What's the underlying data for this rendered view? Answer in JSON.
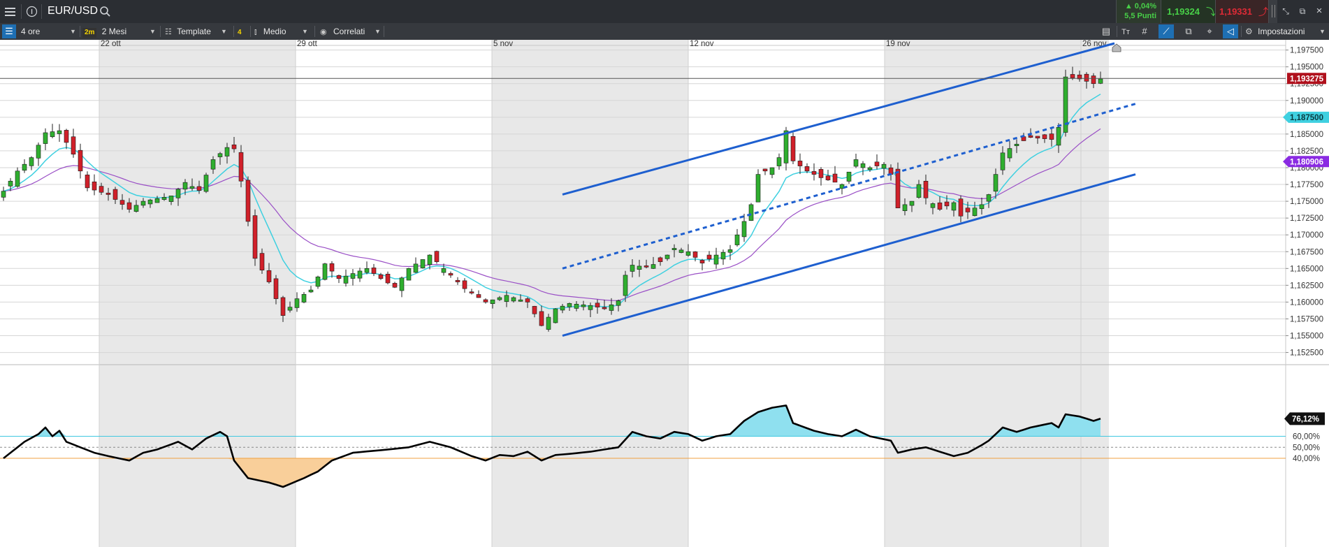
{
  "header": {
    "symbol": "EUR/USD",
    "change_pct": "▲ 0,04%",
    "change_points": "5,5 Punti",
    "sell_price": "1,19324",
    "buy_price": "1,19331"
  },
  "toolbar": {
    "interval_badge": "",
    "interval": "4 ore",
    "range_badge": "2m",
    "range": "2 Mesi",
    "template": "Template",
    "indicator_count": "4",
    "chart_style": "Medio",
    "related": "Correlati",
    "settings": "Impostazioni"
  },
  "icons": {
    "menu": "hamburger-icon",
    "info": "info-icon",
    "search": "search-icon",
    "colors": {
      "up": "#2fae2f",
      "down": "#d0202a",
      "channel": "#1e5fcf",
      "ma_fast": "#3fd0e0",
      "ma_slow": "#9a4fc6",
      "price_tag": "#b0101c",
      "fast_tag": "#3fd0e0",
      "slow_tag": "#8a2be2"
    }
  },
  "chart_data": {
    "type": "candlestick",
    "x_labels": [
      "22 ott",
      "29 ott",
      "5 nov",
      "12 nov",
      "19 nov",
      "26 nov"
    ],
    "y_ticks": [
      "1,197500",
      "1,195000",
      "1,192500",
      "1,190000",
      "1,187500",
      "1,185000",
      "1,182500",
      "1,180000",
      "1,177500",
      "1,175000",
      "1,172500",
      "1,170000",
      "1,167500",
      "1,165000",
      "1,162500",
      "1,160000",
      "1,157500",
      "1,155000",
      "1,152500"
    ],
    "ylim": [
      1.151,
      1.1985
    ],
    "price_tags": {
      "last": "1,193275",
      "ma_fast": "1,187500",
      "ma_slow": "1,180906"
    },
    "price_anchors": [
      [
        0,
        1.1765
      ],
      [
        2,
        1.1795
      ],
      [
        4,
        1.1815
      ],
      [
        6,
        1.1852
      ],
      [
        8,
        1.1855
      ],
      [
        10,
        1.182
      ],
      [
        12,
        1.177
      ],
      [
        15,
        1.176
      ],
      [
        18,
        1.1738
      ],
      [
        20,
        1.175
      ],
      [
        24,
        1.1758
      ],
      [
        26,
        1.1778
      ],
      [
        28,
        1.1766
      ],
      [
        30,
        1.1812
      ],
      [
        32,
        1.183
      ],
      [
        33,
        1.1828
      ],
      [
        34,
        1.178
      ],
      [
        35,
        1.172
      ],
      [
        36,
        1.1665
      ],
      [
        38,
        1.163
      ],
      [
        40,
        1.158
      ],
      [
        42,
        1.1605
      ],
      [
        44,
        1.1618
      ],
      [
        46,
        1.1657
      ],
      [
        48,
        1.1635
      ],
      [
        52,
        1.165
      ],
      [
        54,
        1.1635
      ],
      [
        56,
        1.1622
      ],
      [
        58,
        1.165
      ],
      [
        61,
        1.167
      ],
      [
        64,
        1.164
      ],
      [
        66,
        1.162
      ],
      [
        69,
        1.16
      ],
      [
        72,
        1.161
      ],
      [
        75,
        1.16
      ],
      [
        77,
        1.1565
      ],
      [
        79,
        1.159
      ],
      [
        81,
        1.1598
      ],
      [
        84,
        1.1595
      ],
      [
        86,
        1.159
      ],
      [
        88,
        1.1602
      ],
      [
        89,
        1.164
      ],
      [
        90,
        1.1655
      ],
      [
        92,
        1.1652
      ],
      [
        94,
        1.166
      ],
      [
        96,
        1.168
      ],
      [
        98,
        1.1675
      ],
      [
        100,
        1.1658
      ],
      [
        102,
        1.167
      ],
      [
        104,
        1.1678
      ],
      [
        105,
        1.17
      ],
      [
        106,
        1.172
      ],
      [
        107,
        1.1745
      ],
      [
        108,
        1.179
      ],
      [
        110,
        1.18
      ],
      [
        111,
        1.1815
      ],
      [
        112,
        1.1855
      ],
      [
        113,
        1.181
      ],
      [
        115,
        1.1795
      ],
      [
        117,
        1.1785
      ],
      [
        120,
        1.1775
      ],
      [
        122,
        1.1812
      ],
      [
        124,
        1.18
      ],
      [
        126,
        1.1805
      ],
      [
        127,
        1.179
      ],
      [
        128,
        1.174
      ],
      [
        130,
        1.175
      ],
      [
        131,
        1.1775
      ],
      [
        132,
        1.1755
      ],
      [
        134,
        1.1738
      ],
      [
        136,
        1.1748
      ],
      [
        137,
        1.1728
      ],
      [
        139,
        1.174
      ],
      [
        140,
        1.1745
      ],
      [
        141,
        1.176
      ],
      [
        142,
        1.179
      ],
      [
        143,
        1.1822
      ],
      [
        145,
        1.1835
      ],
      [
        147,
        1.1845
      ],
      [
        150,
        1.1842
      ],
      [
        151,
        1.186
      ],
      [
        152,
        1.1935
      ],
      [
        154,
        1.1932
      ],
      [
        156,
        1.1925
      ],
      [
        157,
        1.1932
      ]
    ],
    "oscillator": {
      "levels": [
        "60,00%",
        "50,00%",
        "40,00%"
      ],
      "last": "76,12%",
      "anchors": [
        [
          0,
          40
        ],
        [
          3,
          55
        ],
        [
          5,
          62
        ],
        [
          6,
          68
        ],
        [
          7,
          60
        ],
        [
          8,
          65
        ],
        [
          9,
          55
        ],
        [
          11,
          50
        ],
        [
          13,
          45
        ],
        [
          15,
          42
        ],
        [
          18,
          38
        ],
        [
          20,
          45
        ],
        [
          22,
          48
        ],
        [
          25,
          55
        ],
        [
          27,
          48
        ],
        [
          29,
          58
        ],
        [
          31,
          64
        ],
        [
          32,
          60
        ],
        [
          33,
          38
        ],
        [
          35,
          22
        ],
        [
          38,
          18
        ],
        [
          40,
          14
        ],
        [
          43,
          22
        ],
        [
          45,
          28
        ],
        [
          47,
          38
        ],
        [
          50,
          45
        ],
        [
          55,
          48
        ],
        [
          58,
          50
        ],
        [
          61,
          55
        ],
        [
          64,
          50
        ],
        [
          67,
          42
        ],
        [
          69,
          38
        ],
        [
          71,
          43
        ],
        [
          73,
          42
        ],
        [
          75,
          46
        ],
        [
          77,
          38
        ],
        [
          79,
          43
        ],
        [
          81,
          44
        ],
        [
          84,
          46
        ],
        [
          86,
          48
        ],
        [
          88,
          50
        ],
        [
          90,
          64
        ],
        [
          92,
          60
        ],
        [
          94,
          58
        ],
        [
          96,
          64
        ],
        [
          98,
          62
        ],
        [
          100,
          56
        ],
        [
          102,
          60
        ],
        [
          104,
          62
        ],
        [
          106,
          74
        ],
        [
          108,
          82
        ],
        [
          110,
          86
        ],
        [
          112,
          88
        ],
        [
          113,
          72
        ],
        [
          116,
          65
        ],
        [
          118,
          62
        ],
        [
          120,
          60
        ],
        [
          122,
          66
        ],
        [
          124,
          60
        ],
        [
          127,
          56
        ],
        [
          128,
          45
        ],
        [
          130,
          48
        ],
        [
          132,
          50
        ],
        [
          134,
          46
        ],
        [
          136,
          42
        ],
        [
          138,
          45
        ],
        [
          140,
          52
        ],
        [
          141,
          56
        ],
        [
          143,
          68
        ],
        [
          145,
          64
        ],
        [
          147,
          68
        ],
        [
          150,
          72
        ],
        [
          151,
          68
        ],
        [
          152,
          80
        ],
        [
          154,
          78
        ],
        [
          156,
          74
        ],
        [
          157,
          76
        ]
      ]
    },
    "channel": {
      "upper": [
        [
          80,
          1.176
        ],
        [
          159,
          1.1985
        ]
      ],
      "middle": [
        [
          80,
          1.165
        ],
        [
          162,
          1.1895
        ]
      ],
      "lower": [
        [
          80,
          1.155
        ],
        [
          162,
          1.179
        ]
      ]
    }
  }
}
